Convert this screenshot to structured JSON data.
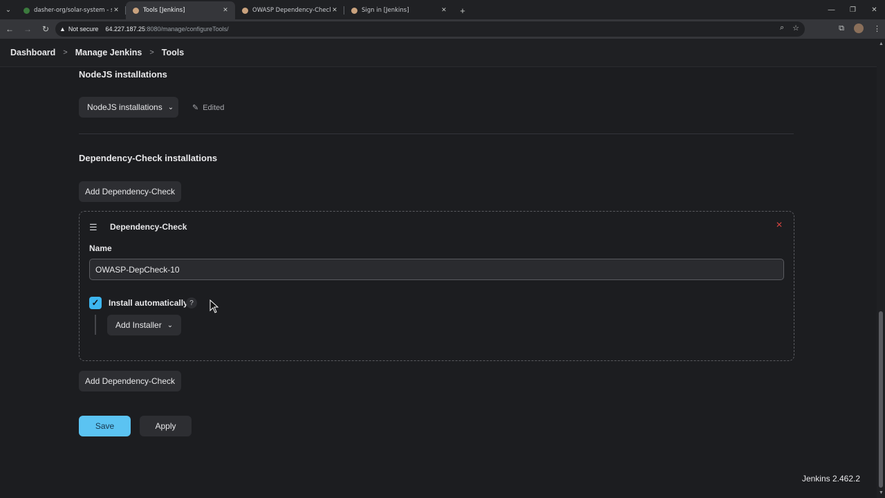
{
  "browser": {
    "tabs": [
      {
        "label": "dasher-org/solar-system - sola",
        "favicon_color": "#3b7a3d",
        "active": false
      },
      {
        "label": "Tools [Jenkins]",
        "favicon_color": "#c9a27e",
        "active": true
      },
      {
        "label": "OWASP Dependency-Check | Je",
        "favicon_color": "#c9a27e",
        "active": false
      },
      {
        "label": "Sign in [Jenkins]",
        "favicon_color": "#c9a27e",
        "active": false
      }
    ],
    "security_label": "Not secure",
    "url_host": "64.227.187.25",
    "url_path": ":8080/manage/configureTools/"
  },
  "breadcrumbs": [
    "Dashboard",
    "Manage Jenkins",
    "Tools"
  ],
  "nodejs": {
    "section_title": "NodeJS installations",
    "dropdown_label": "NodeJS installations",
    "edited_label": "Edited"
  },
  "dependency_check": {
    "section_title": "Dependency-Check installations",
    "add_button_label": "Add Dependency-Check",
    "card": {
      "title": "Dependency-Check",
      "name_label": "Name",
      "name_value": "OWASP-DepCheck-10",
      "install_auto_label": "Install automatically",
      "install_auto_checked": true,
      "help_label": "?",
      "add_installer_label": "Add Installer"
    },
    "add_button_bottom_label": "Add Dependency-Check"
  },
  "actions": {
    "save_label": "Save",
    "apply_label": "Apply"
  },
  "footer": {
    "version": "Jenkins 2.462.2"
  },
  "colors": {
    "accent": "#5bc3f2",
    "checkbox": "#3db6f0",
    "danger": "#d0433f",
    "background": "#1c1d20"
  }
}
